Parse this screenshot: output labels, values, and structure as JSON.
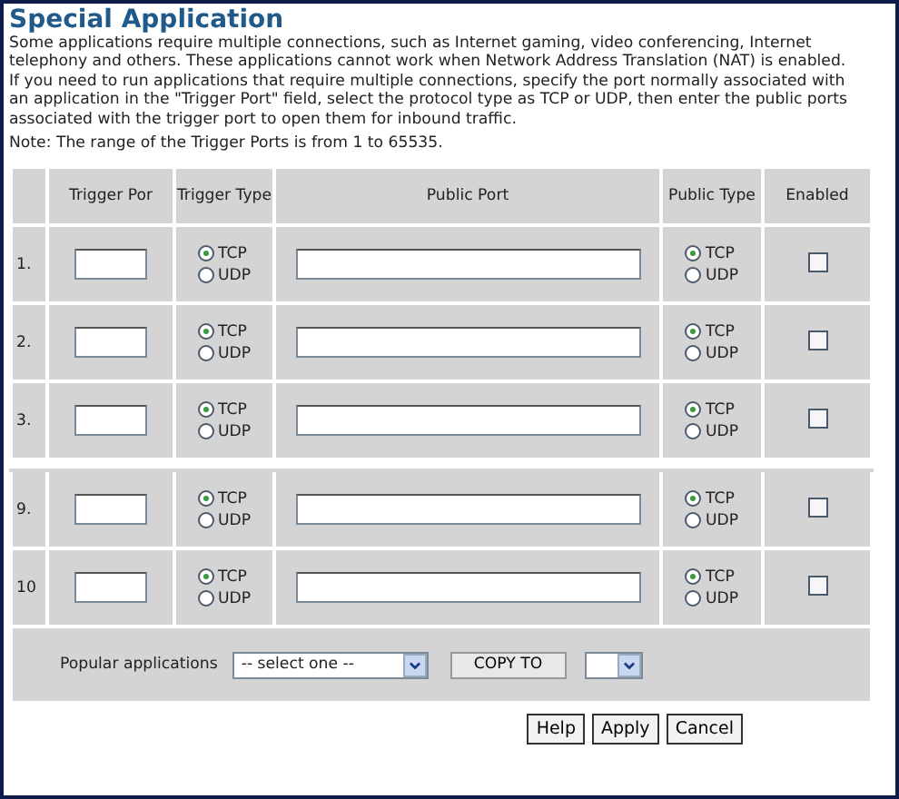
{
  "title": "Special Application",
  "description": "Some applications require multiple connections, such as Internet gaming, video conferencing, Internet telephony and others. These applications cannot work when Network Address Translation (NAT) is enabled. If you need to run applications that require multiple connections, specify the port normally associated with an application in the \"Trigger Port\" field, select the protocol type as TCP or UDP, then enter the public ports associated with the trigger port to open them for inbound traffic.",
  "note": "Note: The range of the Trigger Ports is from 1 to 65535.",
  "table": {
    "columns": [
      "Trigger Por",
      "Trigger Type",
      "Public Port",
      "Public Type",
      "Enabled"
    ],
    "rows": [
      {
        "number": "1.",
        "break_before": false,
        "trigger_type": [
          {
            "label": "TCP",
            "selected": true
          },
          {
            "label": "UDP",
            "selected": false
          }
        ],
        "public_type": [
          {
            "label": "TCP",
            "selected": true
          },
          {
            "label": "UDP",
            "selected": false
          }
        ],
        "enabled": false
      },
      {
        "number": "2.",
        "break_before": false,
        "trigger_type": [
          {
            "label": "TCP",
            "selected": true
          },
          {
            "label": "UDP",
            "selected": false
          }
        ],
        "public_type": [
          {
            "label": "TCP",
            "selected": true
          },
          {
            "label": "UDP",
            "selected": false
          }
        ],
        "enabled": false
      },
      {
        "number": "3.",
        "break_before": false,
        "trigger_type": [
          {
            "label": "TCP",
            "selected": true
          },
          {
            "label": "UDP",
            "selected": false
          }
        ],
        "public_type": [
          {
            "label": "TCP",
            "selected": true
          },
          {
            "label": "UDP",
            "selected": false
          }
        ],
        "enabled": false
      },
      {
        "number": "9.",
        "break_before": true,
        "trigger_type": [
          {
            "label": "TCP",
            "selected": true
          },
          {
            "label": "UDP",
            "selected": false
          }
        ],
        "public_type": [
          {
            "label": "TCP",
            "selected": true
          },
          {
            "label": "UDP",
            "selected": false
          }
        ],
        "enabled": false
      },
      {
        "number": "10",
        "break_before": false,
        "trigger_type": [
          {
            "label": "TCP",
            "selected": true
          },
          {
            "label": "UDP",
            "selected": false
          }
        ],
        "public_type": [
          {
            "label": "TCP",
            "selected": true
          },
          {
            "label": "UDP",
            "selected": false
          }
        ],
        "enabled": false
      }
    ]
  },
  "popular": {
    "label": "Popular applications",
    "select": "-- select one --",
    "copy_button": "COPY TO"
  },
  "buttons": [
    "Help",
    "Apply",
    "Cancel"
  ]
}
